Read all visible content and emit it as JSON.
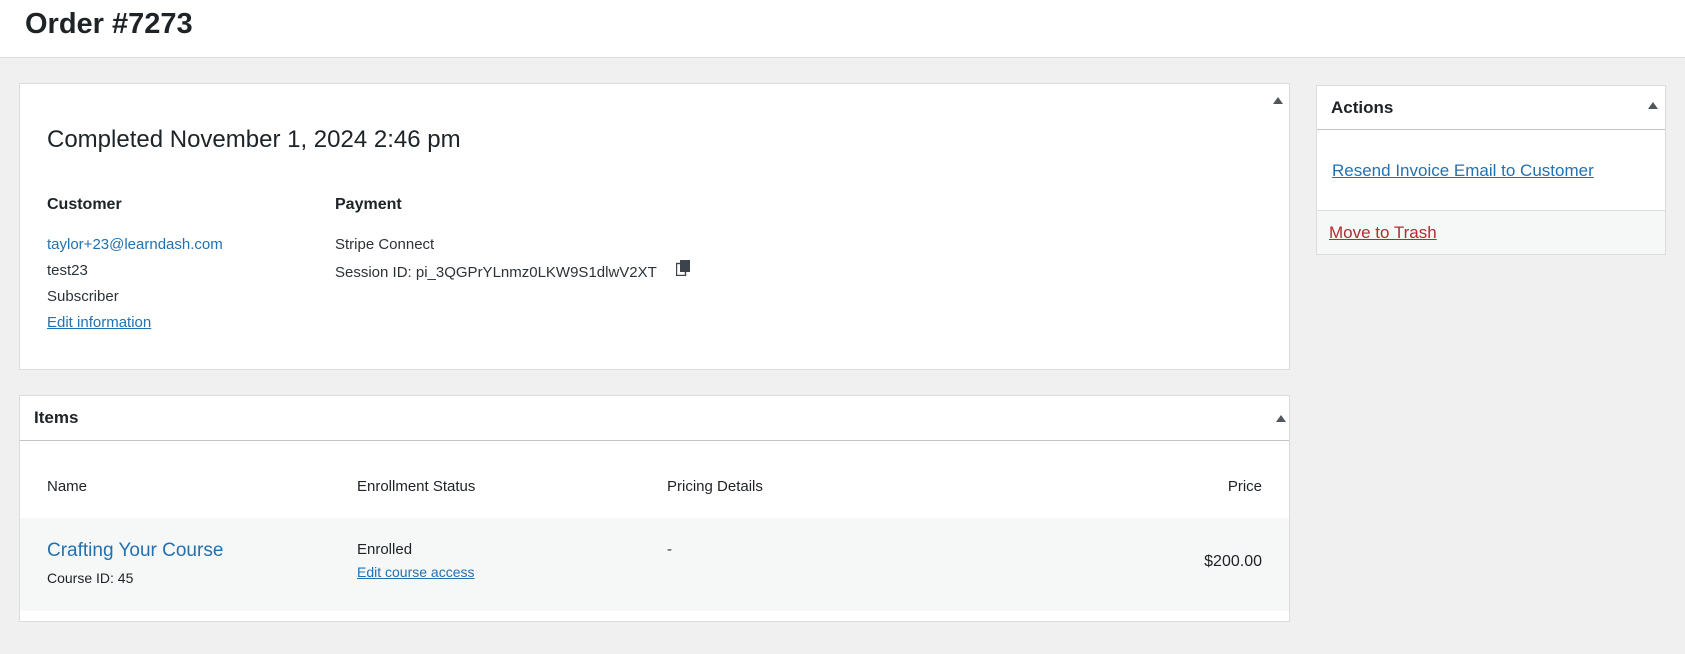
{
  "page": {
    "title": "Order #7273"
  },
  "summary": {
    "status_line": "Completed November 1, 2024 2:46 pm",
    "customer": {
      "heading": "Customer",
      "email": "taylor+23@learndash.com",
      "username": "test23",
      "role": "Subscriber",
      "edit_label": "Edit information"
    },
    "payment": {
      "heading": "Payment",
      "gateway": "Stripe Connect",
      "session": "Session ID: pi_3QGPrYLnmz0LKW9S1dlwV2XT",
      "copy_icon": "copy-icon"
    }
  },
  "items": {
    "title": "Items",
    "columns": [
      "Name",
      "Enrollment Status",
      "Pricing Details",
      "Price"
    ],
    "rows": [
      {
        "name": "Crafting Your Course",
        "course_id": "Course ID: 45",
        "status": "Enrolled",
        "edit_access": "Edit course access",
        "pricing": "-",
        "price": "$200.00"
      }
    ]
  },
  "actions": {
    "title": "Actions",
    "resend": "Resend Invoice Email to Customer",
    "trash": "Move to Trash"
  },
  "colors": {
    "link": "#2271b1",
    "danger": "#b32d2e",
    "background": "#f0f0f1"
  }
}
